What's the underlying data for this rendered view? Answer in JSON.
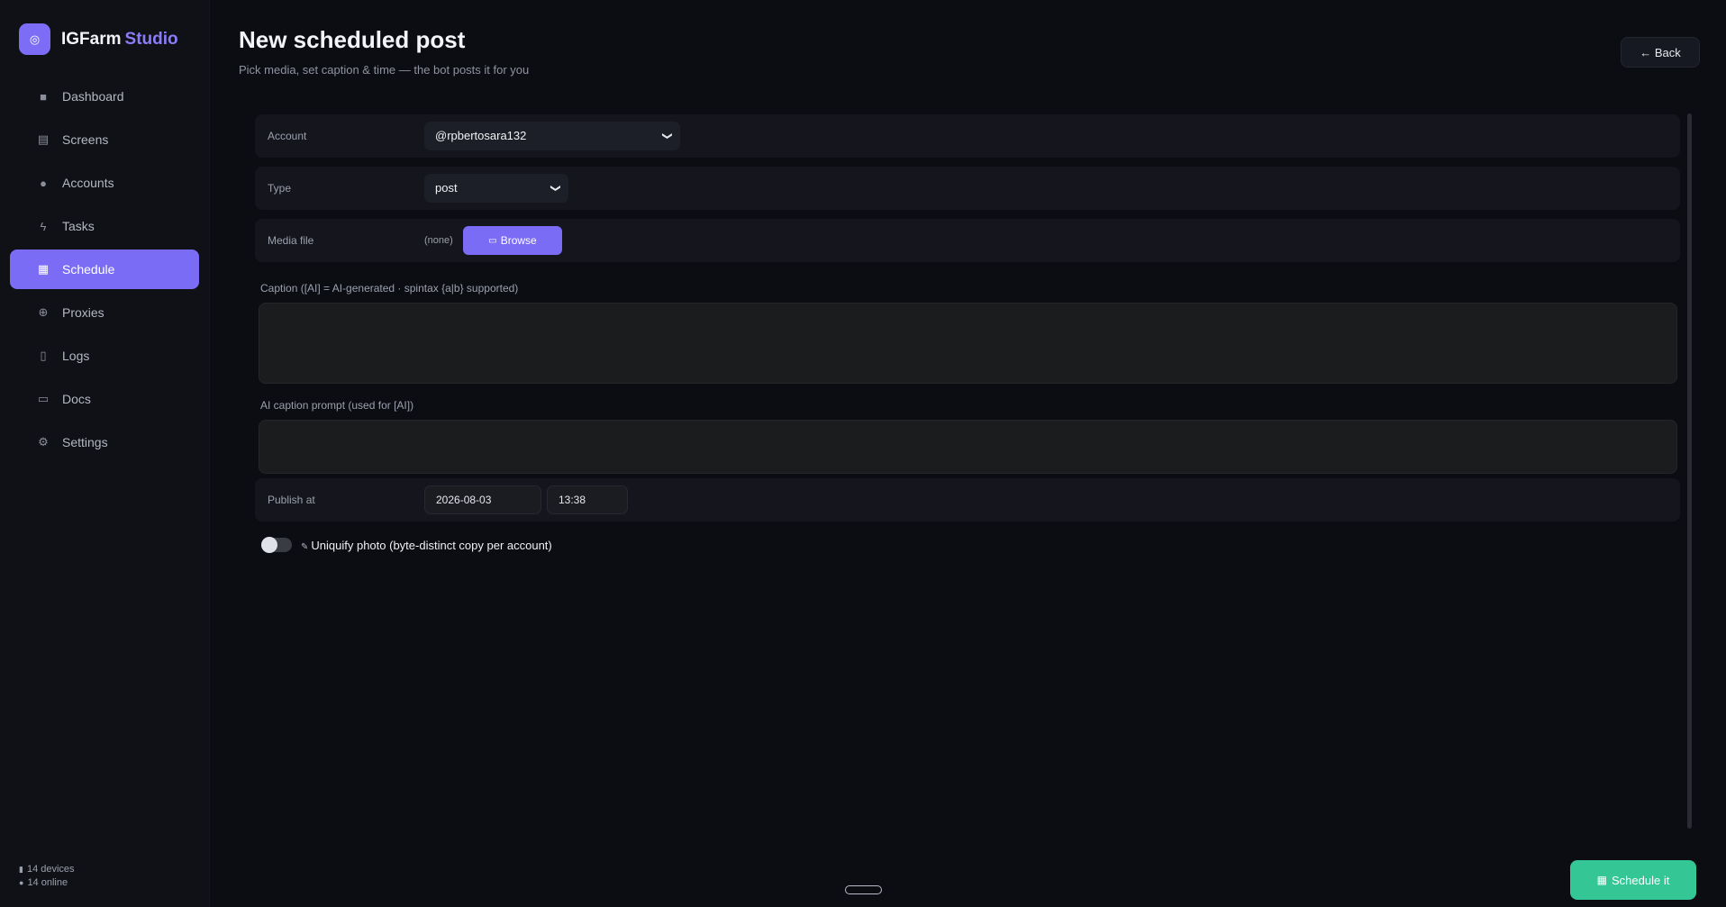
{
  "brand": {
    "logo_glyph": "◎",
    "name": "IGFarm",
    "accent": "Studio"
  },
  "colors": {
    "accent": "#7b6cf6",
    "success": "#34c795",
    "background": "#0c0d12"
  },
  "sidebar": {
    "items": [
      {
        "label": "Dashboard",
        "icon": "dashboard-icon",
        "glyph": "■",
        "active": false
      },
      {
        "label": "Screens",
        "icon": "screens-icon",
        "glyph": "▤",
        "active": false
      },
      {
        "label": "Accounts",
        "icon": "user-icon",
        "glyph": "●",
        "active": false
      },
      {
        "label": "Tasks",
        "icon": "bolt-icon",
        "glyph": "ϟ",
        "active": false
      },
      {
        "label": "Schedule",
        "icon": "calendar-icon",
        "glyph": "▦",
        "active": true
      },
      {
        "label": "Proxies",
        "icon": "globe-icon",
        "glyph": "⊕",
        "active": false
      },
      {
        "label": "Logs",
        "icon": "document-icon",
        "glyph": "▯",
        "active": false
      },
      {
        "label": "Docs",
        "icon": "book-icon",
        "glyph": "▭",
        "active": false
      },
      {
        "label": "Settings",
        "icon": "gear-icon",
        "glyph": "⚙",
        "active": false
      }
    ],
    "devices": "14 devices",
    "online": "14 online"
  },
  "header": {
    "title": "New scheduled post",
    "subtitle": "Pick media, set caption & time — the bot posts it for you",
    "back_label": "← Back"
  },
  "form": {
    "account_label": "Account",
    "account_value": "@rpbertosara132",
    "type_label": "Type",
    "type_value": "post",
    "media_label": "Media file",
    "media_value": "(none)",
    "browse_label": "Browse",
    "caption_label": "Caption ([AI] = AI-generated · spintax {a|b} supported)",
    "caption_value": "",
    "prompt_label": "AI caption prompt (used for [AI])",
    "prompt_value": "",
    "publish_label": "Publish at",
    "publish_date": "2026-08-03",
    "publish_time": "13:38",
    "uniquify_label": "Uniquify photo (byte-distinct copy per account)",
    "uniquify_on": false
  },
  "footer": {
    "schedule_label": "Schedule it"
  }
}
